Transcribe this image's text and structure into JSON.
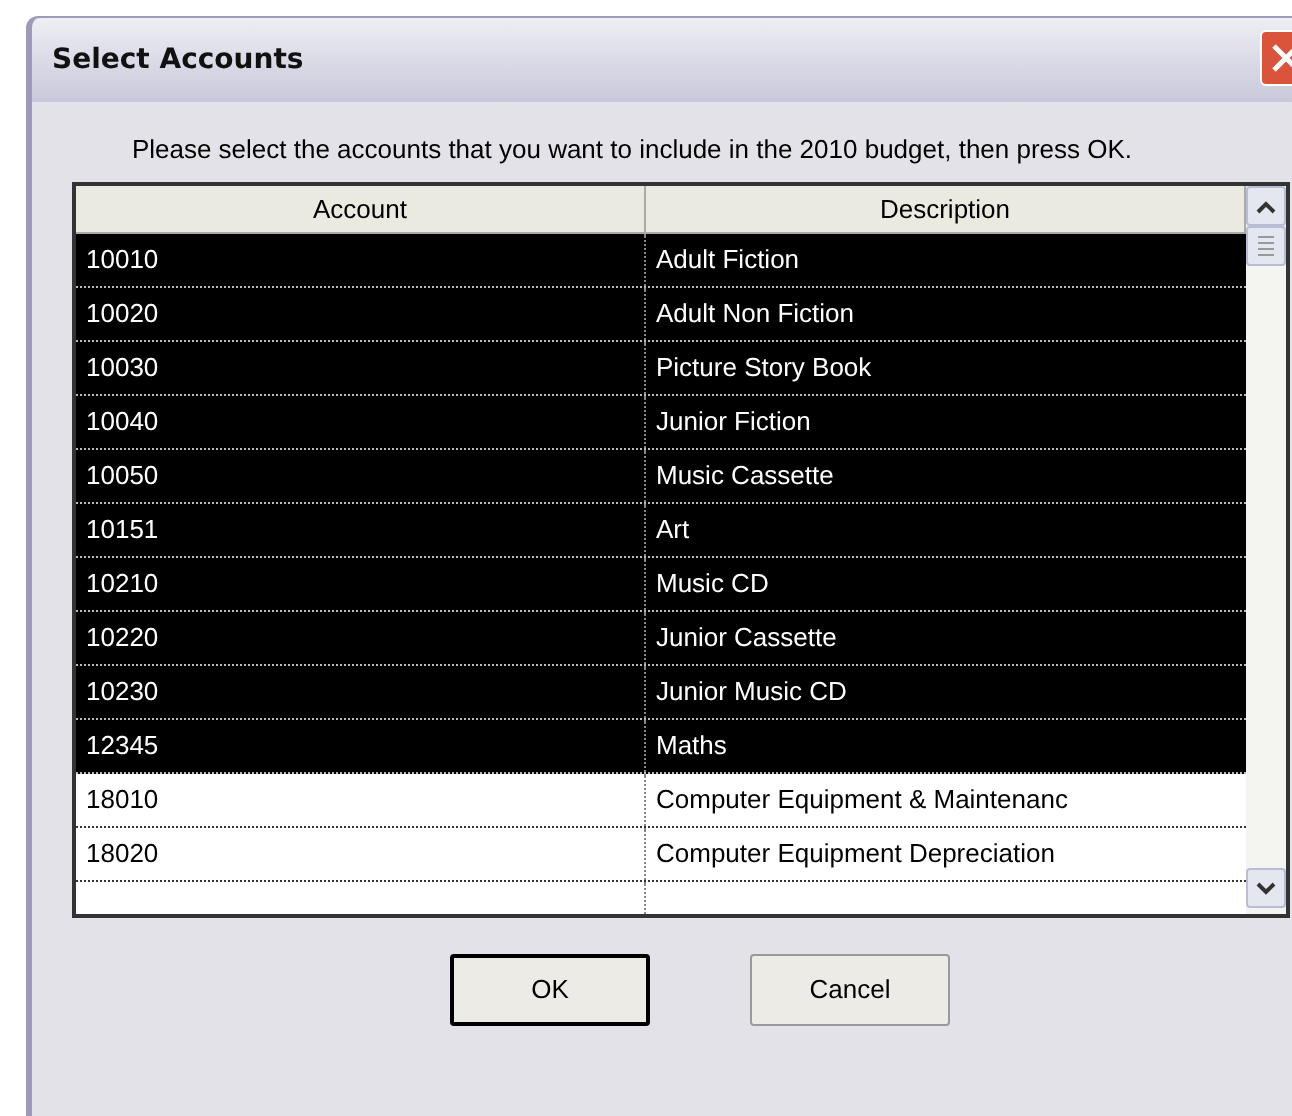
{
  "window": {
    "title": "Select Accounts"
  },
  "instructions": "Please select the accounts that you want to include in the 2010 budget, then press OK.",
  "table": {
    "columns": [
      "Account",
      "Description"
    ],
    "rows": [
      {
        "account": "10010",
        "description": "Adult Fiction",
        "selected": true
      },
      {
        "account": "10020",
        "description": "Adult Non Fiction",
        "selected": true
      },
      {
        "account": "10030",
        "description": "Picture Story Book",
        "selected": true
      },
      {
        "account": "10040",
        "description": "Junior Fiction",
        "selected": true
      },
      {
        "account": "10050",
        "description": "Music Cassette",
        "selected": true
      },
      {
        "account": "10151",
        "description": "Art",
        "selected": true
      },
      {
        "account": "10210",
        "description": "Music CD",
        "selected": true
      },
      {
        "account": "10220",
        "description": "Junior Cassette",
        "selected": true
      },
      {
        "account": "10230",
        "description": "Junior Music CD",
        "selected": true
      },
      {
        "account": "12345",
        "description": "Maths",
        "selected": true
      },
      {
        "account": "18010",
        "description": "Computer Equipment & Maintenanc",
        "selected": false
      },
      {
        "account": "18020",
        "description": "Computer Equipment Depreciation",
        "selected": false
      }
    ]
  },
  "buttons": [
    "OK",
    "Cancel"
  ]
}
